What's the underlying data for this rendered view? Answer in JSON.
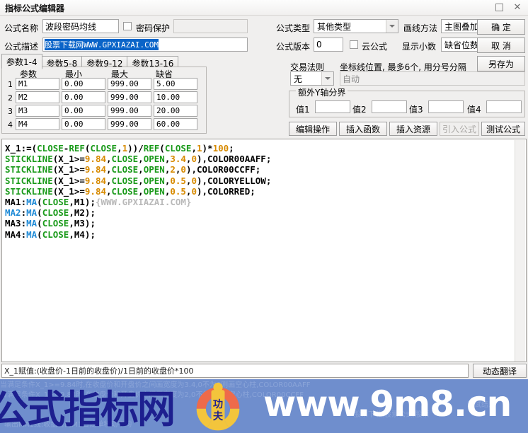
{
  "window": {
    "title": "指标公式编辑器",
    "maximize_icon": "maximize-icon",
    "close_icon": "close-icon"
  },
  "form": {
    "name_label": "公式名称",
    "name_value": "波段密码均线",
    "password_protect_label": "密码保护",
    "password_value": "",
    "desc_label": "公式描述",
    "desc_value": "股票下载网WWW.GPXIAZAI.COM",
    "type_label": "公式类型",
    "type_value": "其他类型",
    "draw_label": "画线方法",
    "draw_value": "主图叠加",
    "version_label": "公式版本",
    "version_value": "0",
    "cloud_label": "云公式",
    "decimal_label": "显示小数",
    "decimal_value": "缺省位数",
    "trade_rule_label": "交易法则",
    "trade_rule_value": "无",
    "coord_label": "坐标线位置, 最多6个, 用分号分隔",
    "coord_placeholder": "自动",
    "extra_axis_group": "额外Y轴分界",
    "extra_axis_fields": [
      {
        "label": "值1",
        "value": ""
      },
      {
        "label": "值2",
        "value": ""
      },
      {
        "label": "值3",
        "value": ""
      },
      {
        "label": "值4",
        "value": ""
      }
    ]
  },
  "tabs": [
    {
      "label": "参数1-4",
      "active": true
    },
    {
      "label": "参数5-8",
      "active": false
    },
    {
      "label": "参数9-12",
      "active": false
    },
    {
      "label": "参数13-16",
      "active": false
    }
  ],
  "param_table": {
    "headers": [
      "参数",
      "最小",
      "最大",
      "缺省"
    ],
    "rows": [
      {
        "no": "1",
        "name": "M1",
        "min": "0.00",
        "max": "999.00",
        "default": "5.00"
      },
      {
        "no": "2",
        "name": "M2",
        "min": "0.00",
        "max": "999.00",
        "default": "10.00"
      },
      {
        "no": "3",
        "name": "M3",
        "min": "0.00",
        "max": "999.00",
        "default": "20.00"
      },
      {
        "no": "4",
        "name": "M4",
        "min": "0.00",
        "max": "999.00",
        "default": "60.00"
      }
    ]
  },
  "buttons": {
    "ok": "确  定",
    "cancel": "取  消",
    "save_as": "另存为",
    "edit_ops": "编辑操作",
    "insert_func": "插入函数",
    "insert_res": "插入资源",
    "import_formula": "引入公式",
    "test_formula": "测试公式",
    "translate": "动态翻译"
  },
  "code": {
    "lines": [
      [
        {
          "t": "X_1:=(",
          "c": "p"
        },
        {
          "t": "CLOSE",
          "c": "k"
        },
        {
          "t": "-",
          "c": "p"
        },
        {
          "t": "REF",
          "c": "k"
        },
        {
          "t": "(",
          "c": "p"
        },
        {
          "t": "CLOSE",
          "c": "k"
        },
        {
          "t": ",",
          "c": "p"
        },
        {
          "t": "1",
          "c": "n"
        },
        {
          "t": "))/",
          "c": "p"
        },
        {
          "t": "REF",
          "c": "k"
        },
        {
          "t": "(",
          "c": "p"
        },
        {
          "t": "CLOSE",
          "c": "k"
        },
        {
          "t": ",",
          "c": "p"
        },
        {
          "t": "1",
          "c": "n"
        },
        {
          "t": ")*",
          "c": "p"
        },
        {
          "t": "100",
          "c": "n"
        },
        {
          "t": ";",
          "c": "p"
        }
      ],
      [
        {
          "t": "STICKLINE",
          "c": "k"
        },
        {
          "t": "(X_1>=",
          "c": "p"
        },
        {
          "t": "9.84",
          "c": "n"
        },
        {
          "t": ",",
          "c": "p"
        },
        {
          "t": "CLOSE",
          "c": "k"
        },
        {
          "t": ",",
          "c": "p"
        },
        {
          "t": "OPEN",
          "c": "k"
        },
        {
          "t": ",",
          "c": "p"
        },
        {
          "t": "3.4",
          "c": "n"
        },
        {
          "t": ",",
          "c": "p"
        },
        {
          "t": "0",
          "c": "n"
        },
        {
          "t": "),COLOR00AAFF;",
          "c": "p"
        }
      ],
      [
        {
          "t": "STICKLINE",
          "c": "k"
        },
        {
          "t": "(X_1>=",
          "c": "p"
        },
        {
          "t": "9.84",
          "c": "n"
        },
        {
          "t": ",",
          "c": "p"
        },
        {
          "t": "CLOSE",
          "c": "k"
        },
        {
          "t": ",",
          "c": "p"
        },
        {
          "t": "OPEN",
          "c": "k"
        },
        {
          "t": ",",
          "c": "p"
        },
        {
          "t": "2",
          "c": "n"
        },
        {
          "t": ",",
          "c": "p"
        },
        {
          "t": "0",
          "c": "n"
        },
        {
          "t": "),COLOR00CCFF;",
          "c": "p"
        }
      ],
      [
        {
          "t": "STICKLINE",
          "c": "k"
        },
        {
          "t": "(X_1>=",
          "c": "p"
        },
        {
          "t": "9.84",
          "c": "n"
        },
        {
          "t": ",",
          "c": "p"
        },
        {
          "t": "CLOSE",
          "c": "k"
        },
        {
          "t": ",",
          "c": "p"
        },
        {
          "t": "OPEN",
          "c": "k"
        },
        {
          "t": ",",
          "c": "p"
        },
        {
          "t": "0.5",
          "c": "n"
        },
        {
          "t": ",",
          "c": "p"
        },
        {
          "t": "0",
          "c": "n"
        },
        {
          "t": "),COLORYELLOW;",
          "c": "p"
        }
      ],
      [
        {
          "t": "STICKLINE",
          "c": "k"
        },
        {
          "t": "(X_1>=",
          "c": "p"
        },
        {
          "t": "9.84",
          "c": "n"
        },
        {
          "t": ",",
          "c": "p"
        },
        {
          "t": "CLOSE",
          "c": "k"
        },
        {
          "t": ",",
          "c": "p"
        },
        {
          "t": "OPEN",
          "c": "k"
        },
        {
          "t": ",",
          "c": "p"
        },
        {
          "t": "0.5",
          "c": "n"
        },
        {
          "t": ",",
          "c": "p"
        },
        {
          "t": "0",
          "c": "n"
        },
        {
          "t": "),COLORRED;",
          "c": "p"
        }
      ],
      [
        {
          "t": "MA1:",
          "c": "p"
        },
        {
          "t": "MA",
          "c": "b"
        },
        {
          "t": "(",
          "c": "p"
        },
        {
          "t": "CLOSE",
          "c": "k"
        },
        {
          "t": ",M1);",
          "c": "p"
        },
        {
          "t": "{WWW.GPXIAZAI.COM}",
          "c": "cm"
        }
      ],
      [
        {
          "t": "MA2",
          "c": "b"
        },
        {
          "t": ":",
          "c": "p"
        },
        {
          "t": "MA",
          "c": "b"
        },
        {
          "t": "(",
          "c": "p"
        },
        {
          "t": "CLOSE",
          "c": "k"
        },
        {
          "t": ",M2);",
          "c": "p"
        }
      ],
      [
        {
          "t": "MA3:",
          "c": "p"
        },
        {
          "t": "MA",
          "c": "b"
        },
        {
          "t": "(",
          "c": "p"
        },
        {
          "t": "CLOSE",
          "c": "k"
        },
        {
          "t": ",M3);",
          "c": "p"
        }
      ],
      [
        {
          "t": "MA4:",
          "c": "p"
        },
        {
          "t": "MA",
          "c": "b"
        },
        {
          "t": "(",
          "c": "p"
        },
        {
          "t": "CLOSE",
          "c": "k"
        },
        {
          "t": ",M4);",
          "c": "p"
        }
      ]
    ]
  },
  "status": {
    "text": "X_1赋值:(收盘价-1日前的收盘价)/1日前的收盘价*100"
  },
  "watermark": {
    "site_cn": "公式指标网",
    "site_url": "www.9m8.cn",
    "logo_text": "www.9m8.cn",
    "ghost_line1": "当满足条件X_1>=9.84时,在收盘价和开盘价之间画宽度为3.4,0不为0则画空心柱,COLOR00AAFF",
    "ghost_line2": "当满足条件X_1>=9.84时,在收盘价和开盘价之间画宽度为2,0不为0则画空心柱,COLOR00CCFF",
    "ghost_line3": "测试结果",
    "ghost_line4": "股票下载,股票公式,股票",
    "ghost_line5": "输出MA1线:收盘价的M1日简单移动平均"
  },
  "colors": {
    "accent_green": "#1a9a1a",
    "accent_orange": "#d78a00",
    "accent_blue": "#1e8ad6",
    "selection_blue": "#0a64c8",
    "watermark_band": "#6f8ecd",
    "watermark_cn": "#1d1f8f"
  }
}
